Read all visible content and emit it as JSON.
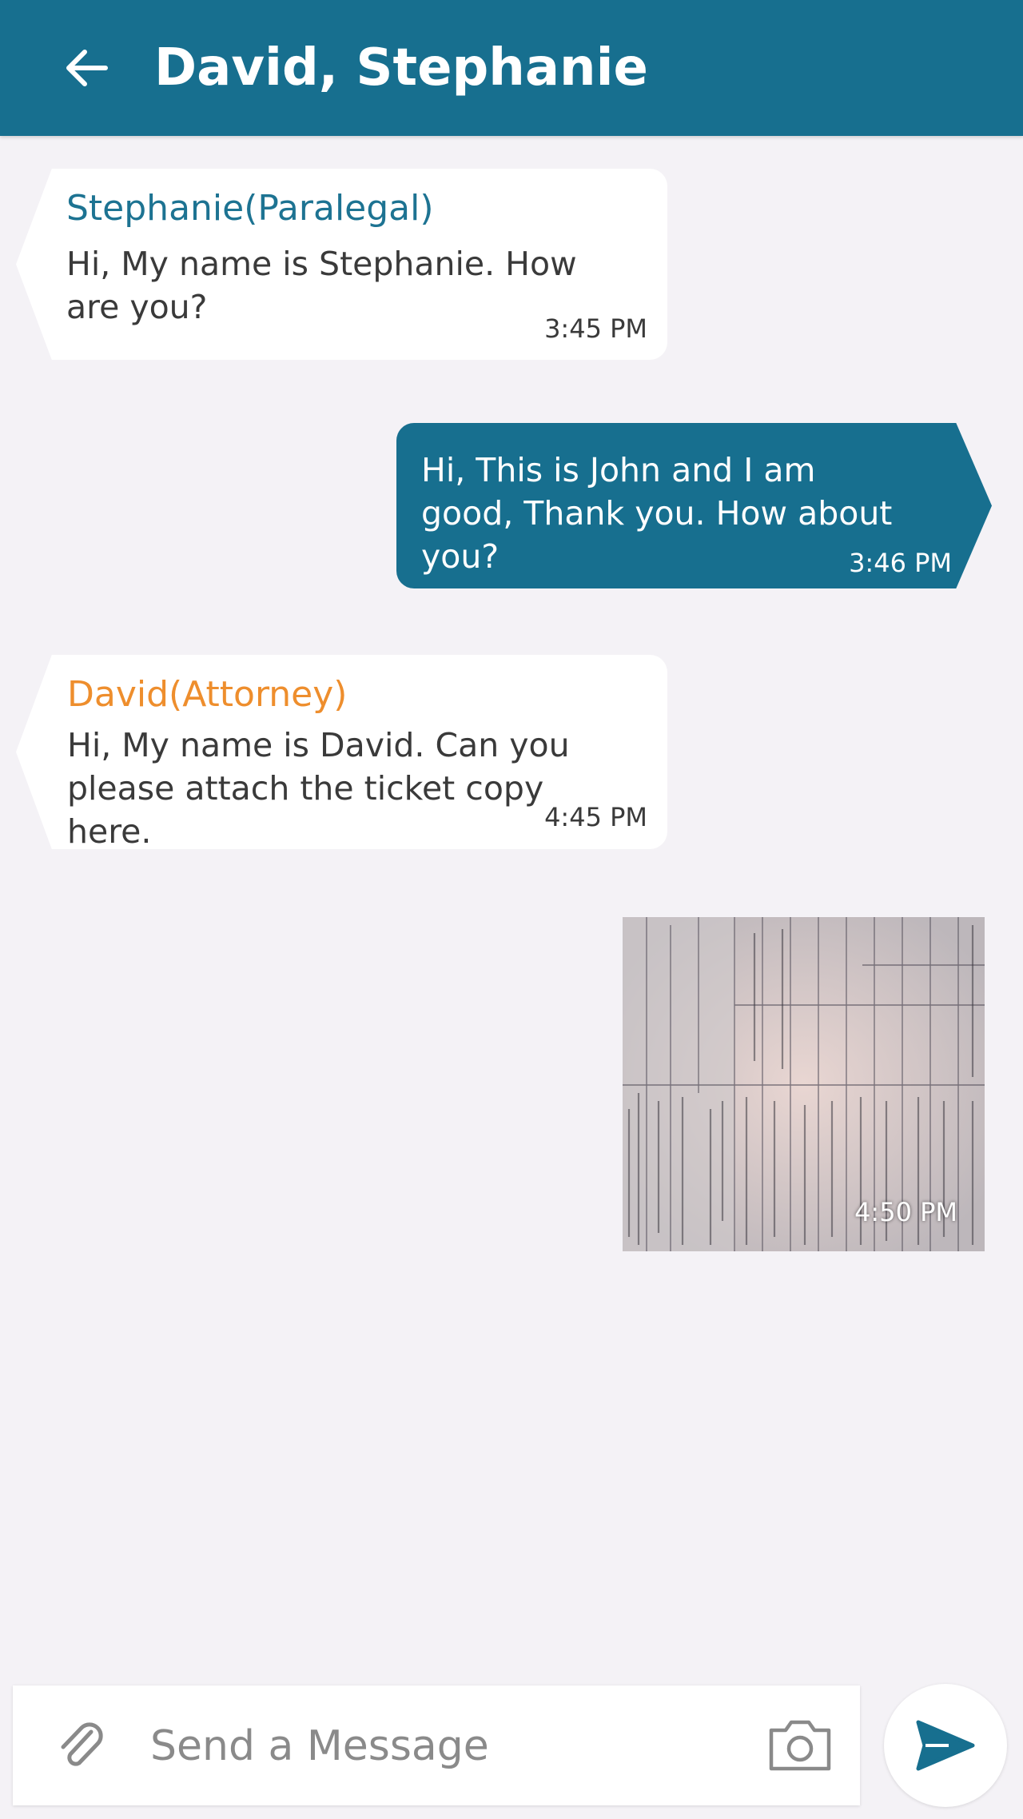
{
  "header": {
    "back_icon": "arrow-left-icon",
    "title": "David, Stephanie"
  },
  "colors": {
    "header_bg": "#176f8f",
    "outgoing_bubble": "#176f8f",
    "paralegal_name": "#1d7392",
    "attorney_name": "#ee8e2d",
    "background": "#f4f2f6"
  },
  "messages": [
    {
      "sender": "Stephanie(Paralegal)",
      "text": "Hi, My name is Stephanie. How are you?",
      "time": "3:45 PM"
    },
    {
      "text": "Hi, This is John and I am  good, Thank you. How about you?",
      "time": "3:46 PM"
    },
    {
      "sender": "David(Attorney)",
      "text": "Hi, My name is David. Can you please attach the ticket copy here.",
      "time": "4:45 PM"
    },
    {
      "attachment_icon": "ticket-photo",
      "time": "4:50 PM"
    }
  ],
  "composer": {
    "attach_icon": "paperclip-icon",
    "placeholder": "Send a Message",
    "camera_icon": "camera-icon",
    "send_icon": "send-icon"
  }
}
